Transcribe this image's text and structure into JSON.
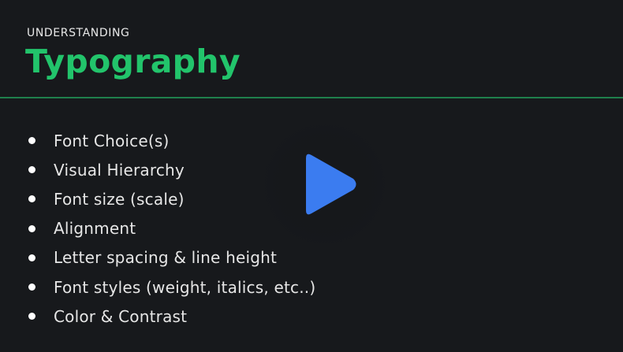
{
  "header": {
    "eyebrow": "UNDERSTANDING",
    "title": "Typography"
  },
  "bullets": [
    "Font Choice(s)",
    "Visual Hierarchy",
    "Font size (scale)",
    "Alignment",
    "Letter spacing & line height",
    "Font styles (weight, italics, etc..)",
    "Color & Contrast"
  ],
  "player": {
    "icon": "play-icon",
    "accent_color": "#3b7cf0"
  },
  "colors": {
    "background": "#17191c",
    "title_green": "#22c46b",
    "divider_green": "#1f7f4c",
    "text": "#e6e6e6"
  }
}
